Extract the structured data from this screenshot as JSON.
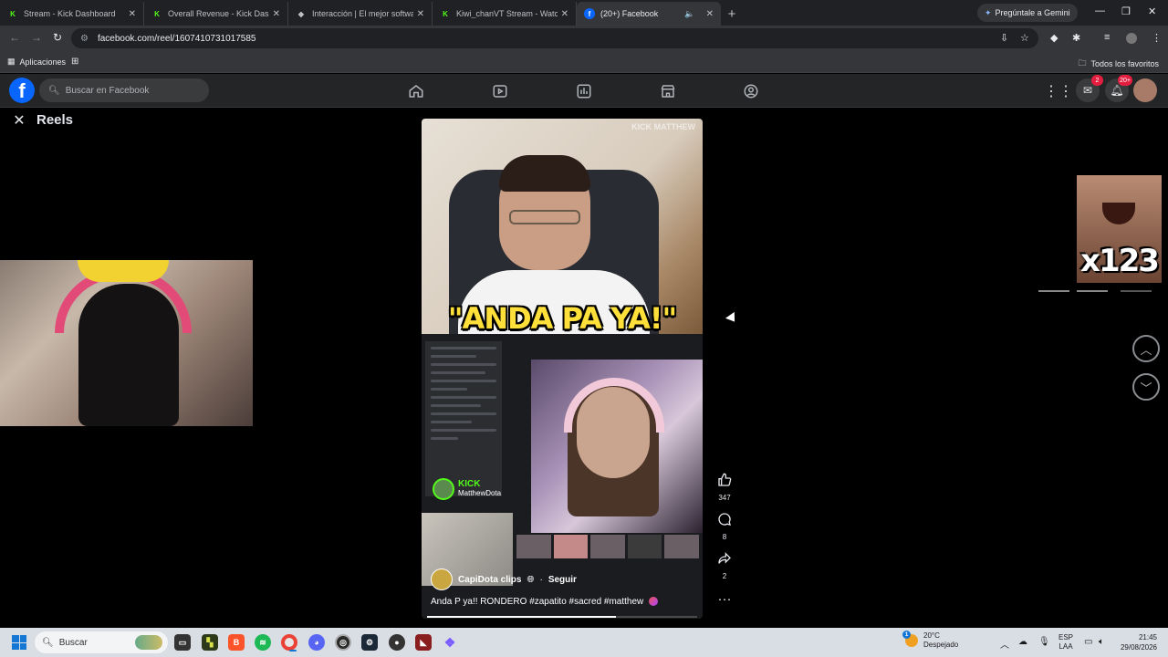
{
  "browser": {
    "tabs": [
      {
        "title": "Stream - Kick Dashboard",
        "favicon": "K",
        "favicon_color": "#53fc18"
      },
      {
        "title": "Overall Revenue - Kick Dashboard",
        "favicon": "K",
        "favicon_color": "#53fc18"
      },
      {
        "title": "Interacción | El mejor software para",
        "favicon": "◆",
        "favicon_color": "#ffffff"
      },
      {
        "title": "Kiwi_chanVT Stream - Watch Live",
        "favicon": "K",
        "favicon_color": "#53fc18"
      },
      {
        "title": "(20+) Facebook",
        "favicon": "f",
        "favicon_color": "#0866ff"
      }
    ],
    "gemini_label": "Pregúntale a Gemini",
    "url": "facebook.com/reel/1607410731017585",
    "bookmarks": {
      "apps_label": "Aplicaciones",
      "all_label": "Todos los favoritos"
    }
  },
  "facebook": {
    "logo": "f",
    "search_placeholder": "Buscar en Facebook",
    "messenger_badge": "2",
    "notifications_badge": "20+",
    "brand_color": "#0866ff"
  },
  "reels": {
    "title": "Reels",
    "video_caption_overlay": "\"ANDA PA YA!\"",
    "video_watermark": "KICK MATTHEW",
    "kick_label": "KICK",
    "kick_channel": "MatthewDota",
    "overlay_meme_text": "x123",
    "author": "CapiDota clips",
    "follow_label": "Seguir",
    "caption": "Anda P ya!! RONDERO #zapatito #sacred #matthew",
    "progress_percent": 70,
    "likes": "347",
    "comments": "8",
    "shares": "2"
  },
  "taskbar": {
    "search_label": "Buscar",
    "weather_temp": "20°C",
    "weather_desc": "Despejado",
    "weather_badge": "1",
    "lang_top": "ESP",
    "lang_bottom": "LAA",
    "time": "21:45",
    "date": "29/08/2026"
  }
}
